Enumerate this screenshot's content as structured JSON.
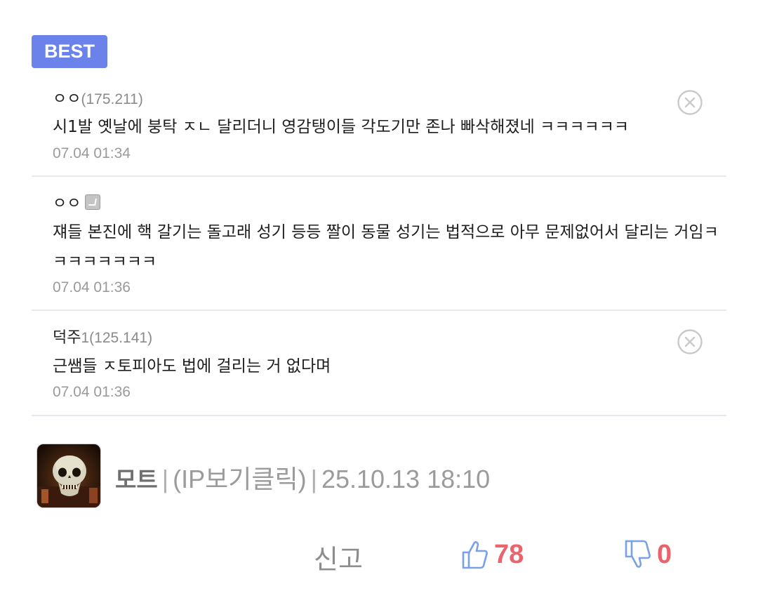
{
  "best_label": "BEST",
  "comments": [
    {
      "nick": "ㅇㅇ",
      "ip": "(175.211)",
      "text": "시1발 옛날에 붕탁 ㅈㄴ 달리더니 영감탱이들 각도기만 존나 빠삭해졌네 ㅋㅋㅋㅋㅋㅋ",
      "time": "07.04 01:34"
    },
    {
      "nick": "ㅇㅇ",
      "ip": "",
      "text": "쟤들 본진에 핵 갈기는 돌고래 성기 등등 짤이 동물 성기는 법적으로 아무 문제없어서 달리는 거임ㅋㅋㅋㅋㅋㅋㅋㅋ",
      "time": "07.04 01:36"
    },
    {
      "nick": "덕주",
      "nick_suffix": "1",
      "ip": "(125.141)",
      "text": "근쌤들 ㅈ토피아도 법에 걸리는 거 없다며",
      "time": "07.04 01:36"
    }
  ],
  "author": {
    "nick": "모트",
    "ip_label": "(IP보기클릭)",
    "datetime": "25.10.13 18:10"
  },
  "actions": {
    "report_label": "신고",
    "like_count": "78",
    "dislike_count": "0"
  },
  "colors": {
    "best_badge": "#6b82ea",
    "vote_count": "#e9646c",
    "thumb_icon": "#7aa0e8"
  }
}
